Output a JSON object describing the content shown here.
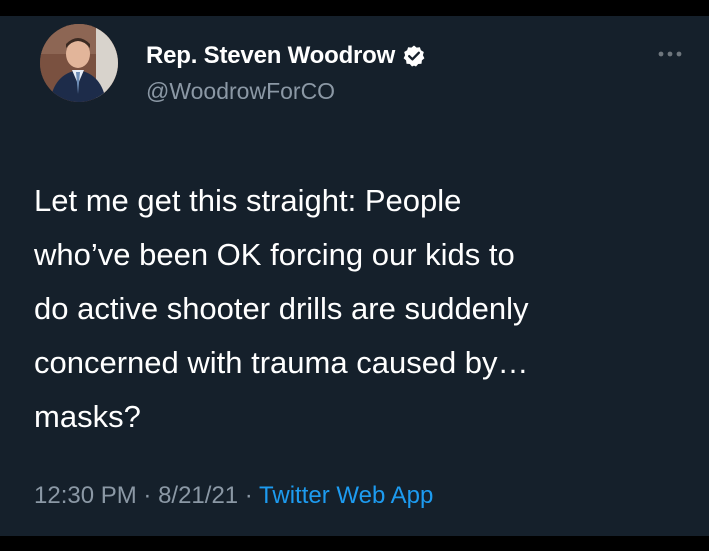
{
  "tweet": {
    "author": {
      "display_name": "Rep. Steven Woodrow",
      "handle": "@WoodrowForCO",
      "verified": true
    },
    "text": "Let me get this straight: People\nwho’ve been OK forcing our kids to\ndo active shooter drills are suddenly\nconcerned with trauma caused by…\nmasks?",
    "time": "12:30 PM",
    "separator": " · ",
    "date": "8/21/21",
    "source": "Twitter Web App"
  },
  "icons": {
    "verified": "verified-badge-icon",
    "more": "more-options-icon"
  },
  "colors": {
    "background": "#15202b",
    "text": "#ffffff",
    "secondary": "#8b98a5",
    "link": "#1d9bf0"
  }
}
